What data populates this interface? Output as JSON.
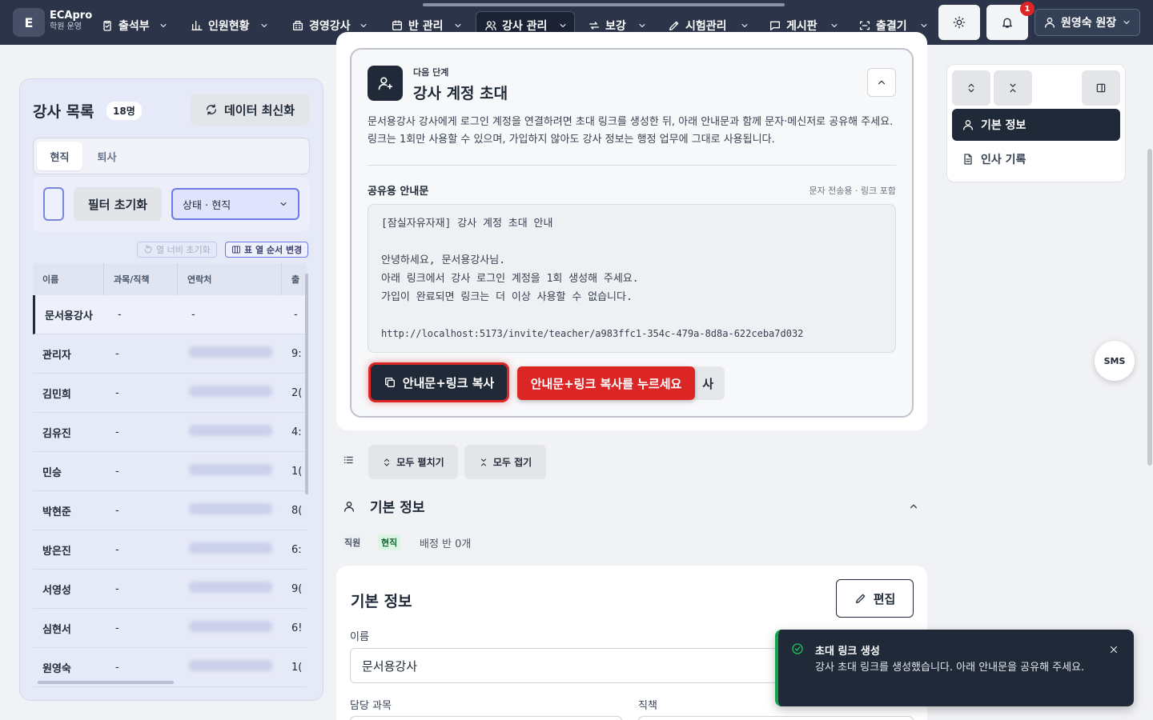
{
  "brand": {
    "logo_letter": "E",
    "name": "ECApro",
    "subtitle": "학원 운영"
  },
  "nav": {
    "items": [
      {
        "label": "출석부",
        "icon": "clipboard-check-icon"
      },
      {
        "label": "인원현황",
        "icon": "bar-chart-icon"
      },
      {
        "label": "경영강사",
        "icon": "building-icon"
      },
      {
        "label": "반 관리",
        "icon": "calendar-icon"
      },
      {
        "label": "강사 관리",
        "icon": "users-icon",
        "active": true
      },
      {
        "label": "보강",
        "icon": "repeat-icon"
      },
      {
        "label": "시험관리",
        "icon": "pen-icon"
      },
      {
        "label": "게시판",
        "icon": "message-square-icon"
      },
      {
        "label": "출결기",
        "icon": "scan-icon"
      }
    ],
    "notification_count": "1",
    "user_label": "원영숙 원장"
  },
  "teacher_list": {
    "title": "강사 목록",
    "count": "18명",
    "refresh_label": "데이터 최신화",
    "tabs": [
      "현직",
      "퇴사"
    ],
    "filter_reset": "필터 초기화",
    "status_select": "상태 · 현직",
    "col_width_reset": "열 너비 초기화",
    "col_order_change": "표 열 순서 변경",
    "columns": [
      "이름",
      "과목/직책",
      "연락처",
      "출"
    ],
    "rows": [
      {
        "name": "문서용강사",
        "subject": "-",
        "contact": "-",
        "extra": "-"
      },
      {
        "name": "관리자",
        "subject": "-",
        "contact": "",
        "extra": "9:"
      },
      {
        "name": "김민희",
        "subject": "-",
        "contact": "",
        "extra": "2("
      },
      {
        "name": "김유진",
        "subject": "-",
        "contact": "",
        "extra": "4:"
      },
      {
        "name": "민승",
        "subject": "-",
        "contact": "",
        "extra": "1("
      },
      {
        "name": "박현준",
        "subject": "-",
        "contact": "",
        "extra": "8("
      },
      {
        "name": "방은진",
        "subject": "-",
        "contact": "",
        "extra": "6:"
      },
      {
        "name": "서영성",
        "subject": "-",
        "contact": "",
        "extra": "9("
      },
      {
        "name": "심현서",
        "subject": "-",
        "contact": "",
        "extra": "6!"
      },
      {
        "name": "원영숙",
        "subject": "-",
        "contact": "",
        "extra": "1("
      }
    ]
  },
  "invite": {
    "step_label": "다음 단계",
    "title": "강사 계정 초대",
    "description": "문서용강사 강사에게 로그인 계정을 연결하려면 초대 링크를 생성한 뒤, 아래 안내문과 함께 문자·메신저로 공유해 주세요. 링크는 1회만 사용할 수 있으며, 가입하지 않아도 강사 정보는 행정 업무에 그대로 사용됩니다.",
    "share_label": "공유용 안내문",
    "share_hint": "문자 전송용 · 링크 포함",
    "message_lines": [
      "[잠실자유자재] 강사 계정 초대 안내",
      "",
      "안녕하세요, 문서용강사님.",
      "아래 링크에서 강사 로그인 계정을 1회 생성해 주세요.",
      "가입이 완료되면 링크는 더 이상 사용할 수 없습니다.",
      "",
      "http://localhost:5173/invite/teacher/a983ffc1-354c-479a-8d8a-622ceba7d032"
    ],
    "copy_button": "안내문+링크 복사",
    "second_button_tail": "사",
    "callout": "안내문+링크 복사를 누르세요"
  },
  "controls": {
    "expand_all": "모두 펼치기",
    "collapse_all": "모두 접기"
  },
  "basic_section": {
    "heading": "기본 정보",
    "chip_staff": "직원",
    "chip_status": "현직",
    "assigned": "배정 반 0개"
  },
  "basic_card": {
    "title": "기본 정보",
    "edit_label": "편집",
    "name_label": "이름",
    "name_value": "문서용강사",
    "subject_label": "담당 과목",
    "role_label": "직책"
  },
  "right_nav": {
    "items": [
      "기본 정보",
      "인사 기록"
    ]
  },
  "sms_label": "SMS",
  "toast": {
    "title": "초대 링크 생성",
    "message": "강사 초대 링크를 생성했습니다. 아래 안내문을 공유해 주세요."
  },
  "colors": {
    "nav_bg": "#2b3448",
    "primary": "#1f2937",
    "callout": "#dc2626",
    "success": "#16a34a",
    "panel_bg": "#e6e9f7"
  }
}
